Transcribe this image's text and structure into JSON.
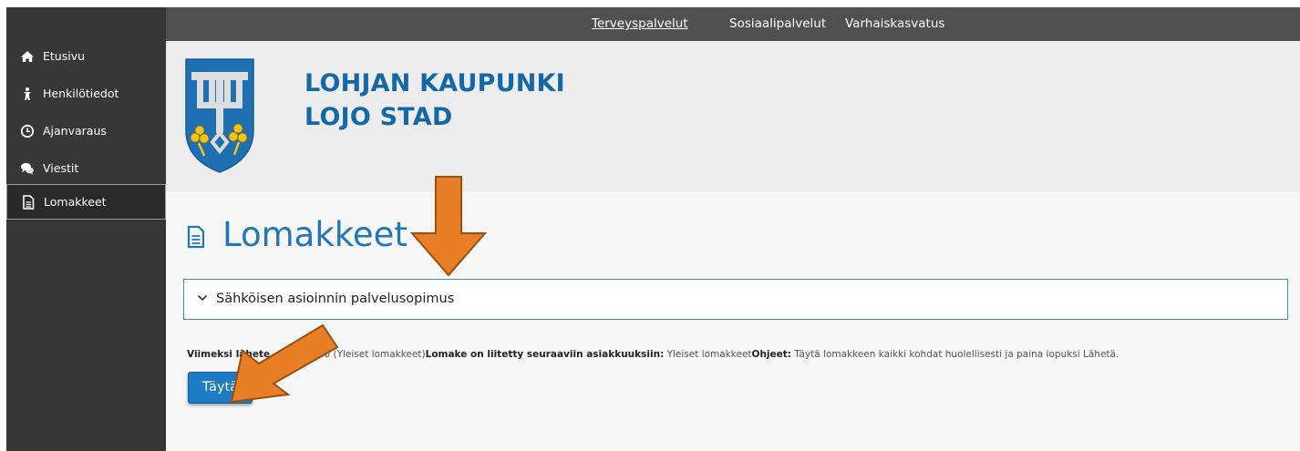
{
  "topnav": {
    "items": [
      {
        "label": "Terveyspalvelut",
        "active": true
      },
      {
        "label": "Sosiaalipalvelut",
        "active": false
      },
      {
        "label": "Varhaiskasvatus",
        "active": false
      }
    ]
  },
  "sidebar": {
    "items": [
      {
        "label": "Etusivu",
        "icon": "home-icon",
        "active": false
      },
      {
        "label": "Henkilötiedot",
        "icon": "person-icon",
        "active": false
      },
      {
        "label": "Ajanvaraus",
        "icon": "clock-icon",
        "active": false
      },
      {
        "label": "Viestit",
        "icon": "chat-icon",
        "active": false
      },
      {
        "label": "Lomakkeet",
        "icon": "document-icon",
        "active": true
      }
    ]
  },
  "header": {
    "brand_line1": "LOHJAN KAUPUNKI",
    "brand_line2": "LOJO STAD"
  },
  "main": {
    "page_title": "Lomakkeet",
    "accordion_title": "Sähköisen asioinnin palvelusopimus",
    "info": {
      "part1_label": "Viimeksi lähete",
      "part1_value": "020 (Yleiset lomakkeet)",
      "part2_label": "Lomake on liitetty seuraaviin asiakkuuksiin:",
      "part2_value": " Yleiset lomakkeet",
      "part3_label": "Ohjeet:",
      "part3_value": " Täytä lomakkeen kaikki kohdat huolellisesti ja paina lopuksi Lähetä."
    },
    "fill_button": "Täytä"
  },
  "colors": {
    "sidebar_bg": "#373737",
    "topbar_bg": "#505050",
    "header_bg": "#ececec",
    "brand_blue": "#1468a8",
    "title_blue": "#2277b7",
    "button_blue": "#1b7bc4",
    "arrow_orange": "#e87e26"
  }
}
